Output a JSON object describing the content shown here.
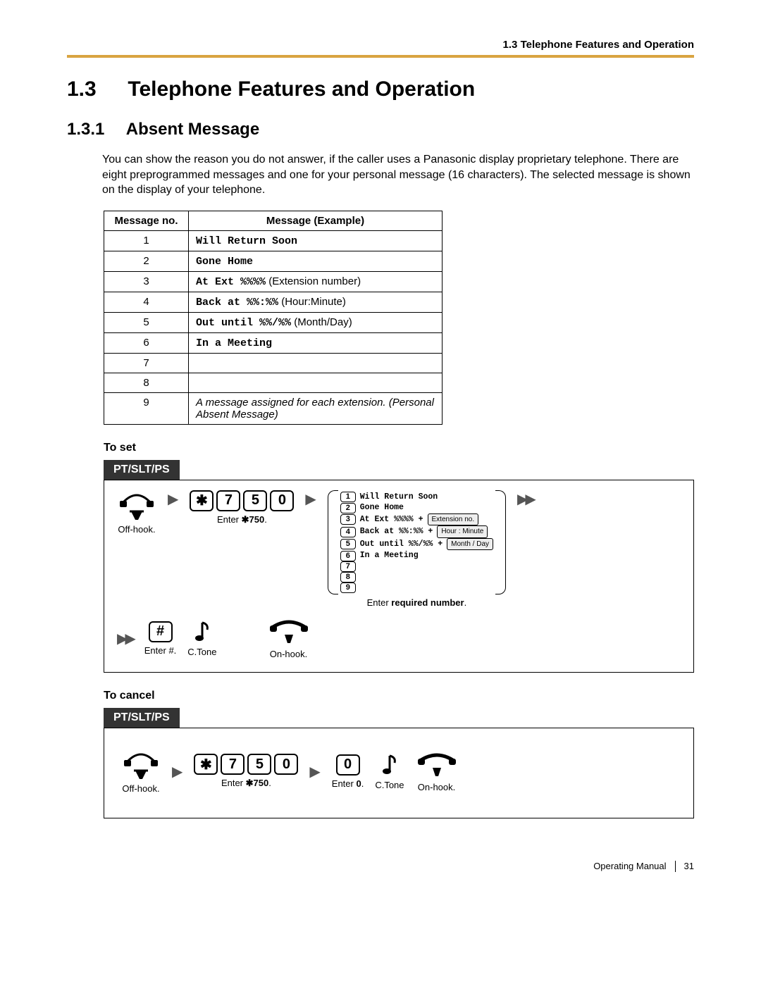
{
  "header": {
    "running": "1.3 Telephone Features and Operation"
  },
  "section": {
    "num": "1.3",
    "title": "Telephone Features and Operation"
  },
  "subsection": {
    "num": "1.3.1",
    "title": "Absent Message"
  },
  "intro": "You can show the reason you do not answer, if the caller uses a Panasonic display proprietary telephone. There are eight preprogrammed messages and one for your personal message (16 characters). The selected message is shown on the display of your telephone.",
  "table": {
    "head1": "Message no.",
    "head2": "Message (Example)",
    "rows": [
      {
        "no": "1",
        "mono": "Will Return Soon",
        "extra": ""
      },
      {
        "no": "2",
        "mono": "Gone Home",
        "extra": ""
      },
      {
        "no": "3",
        "mono": "At Ext %%%%",
        "extra": " (Extension number)"
      },
      {
        "no": "4",
        "mono": "Back at %%:%%",
        "extra": " (Hour:Minute)"
      },
      {
        "no": "5",
        "mono": "Out until %%/%%",
        "extra": " (Month/Day)"
      },
      {
        "no": "6",
        "mono": "In a Meeting",
        "extra": ""
      },
      {
        "no": "7",
        "mono": "",
        "extra": ""
      },
      {
        "no": "8",
        "mono": "",
        "extra": ""
      },
      {
        "no": "9",
        "mono": "",
        "extra": "",
        "italic": "A message assigned for each extension. (Personal Absent Message)"
      }
    ]
  },
  "toset": {
    "label": "To set",
    "device": "PT/SLT/PS",
    "offhook": "Off-hook.",
    "enter750_pre": "Enter ",
    "enter750_code": "✱750",
    "enter750_post": ".",
    "keys": [
      "✱",
      "7",
      "5",
      "0"
    ],
    "options": [
      {
        "n": "1",
        "text": "Will Return Soon"
      },
      {
        "n": "2",
        "text": "Gone Home"
      },
      {
        "n": "3",
        "text": "At Ext %%%% +",
        "pill": "Extension no."
      },
      {
        "n": "4",
        "text": "Back at %%:%% +",
        "pill": "Hour : Minute"
      },
      {
        "n": "5",
        "text": "Out until %%/%% +",
        "pill": "Month / Day"
      },
      {
        "n": "6",
        "text": "In a Meeting"
      },
      {
        "n": "7",
        "text": ""
      },
      {
        "n": "8",
        "text": ""
      },
      {
        "n": "9",
        "text": ""
      }
    ],
    "enter_req_pre": "Enter ",
    "enter_req_bold": "required number",
    "enter_req_post": ".",
    "hash_key": "#",
    "enter_hash": "Enter #.",
    "ctone": "C.Tone",
    "onhook": "On-hook."
  },
  "tocancel": {
    "label": "To cancel",
    "device": "PT/SLT/PS",
    "offhook": "Off-hook.",
    "keys": [
      "✱",
      "7",
      "5",
      "0"
    ],
    "enter750_pre": "Enter ",
    "enter750_code": "✱750",
    "enter750_post": ".",
    "zero_key": "0",
    "enter0_pre": "Enter ",
    "enter0_bold": "0",
    "enter0_post": ".",
    "ctone": "C.Tone",
    "onhook": "On-hook."
  },
  "footer": {
    "manual": "Operating Manual",
    "page": "31"
  }
}
